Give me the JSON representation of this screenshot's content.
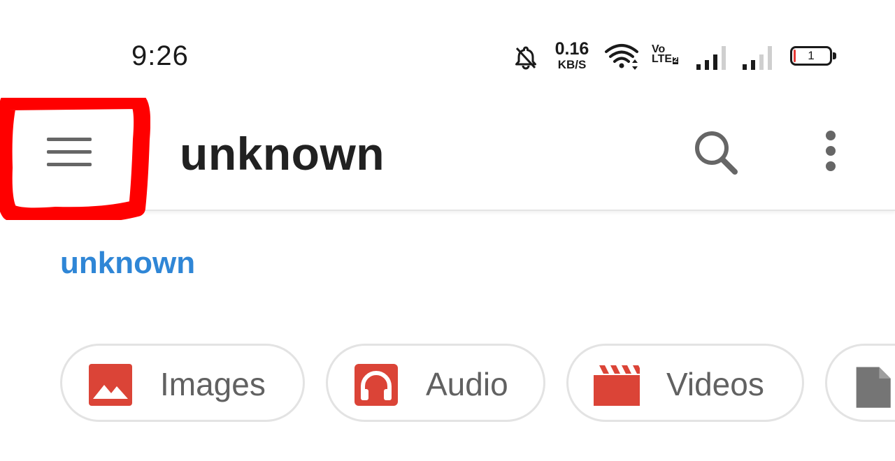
{
  "status_bar": {
    "time": "9:26",
    "net_speed_value": "0.16",
    "net_speed_unit": "KB/S",
    "volte_line1": "Vo",
    "volte_line2": "LTE",
    "volte_sim": "2",
    "battery_level": "1",
    "icons": [
      "bell-off-icon",
      "wifi-icon",
      "signal-icon",
      "signal-icon",
      "battery-icon"
    ]
  },
  "toolbar": {
    "menu_icon": "hamburger-menu-icon",
    "title": "unknown",
    "search_icon": "search-icon",
    "more_icon": "more-vertical-icon"
  },
  "breadcrumb": {
    "label": "unknown"
  },
  "categories": [
    {
      "label": "Images",
      "icon": "image-icon"
    },
    {
      "label": "Audio",
      "icon": "headphones-icon"
    },
    {
      "label": "Videos",
      "icon": "clapperboard-icon"
    },
    {
      "label": "",
      "icon": "document-icon"
    }
  ],
  "colors": {
    "highlight": "#ff0000",
    "accent": "#2f86d6",
    "category_icon": "#db4437",
    "document_icon": "#757575"
  }
}
